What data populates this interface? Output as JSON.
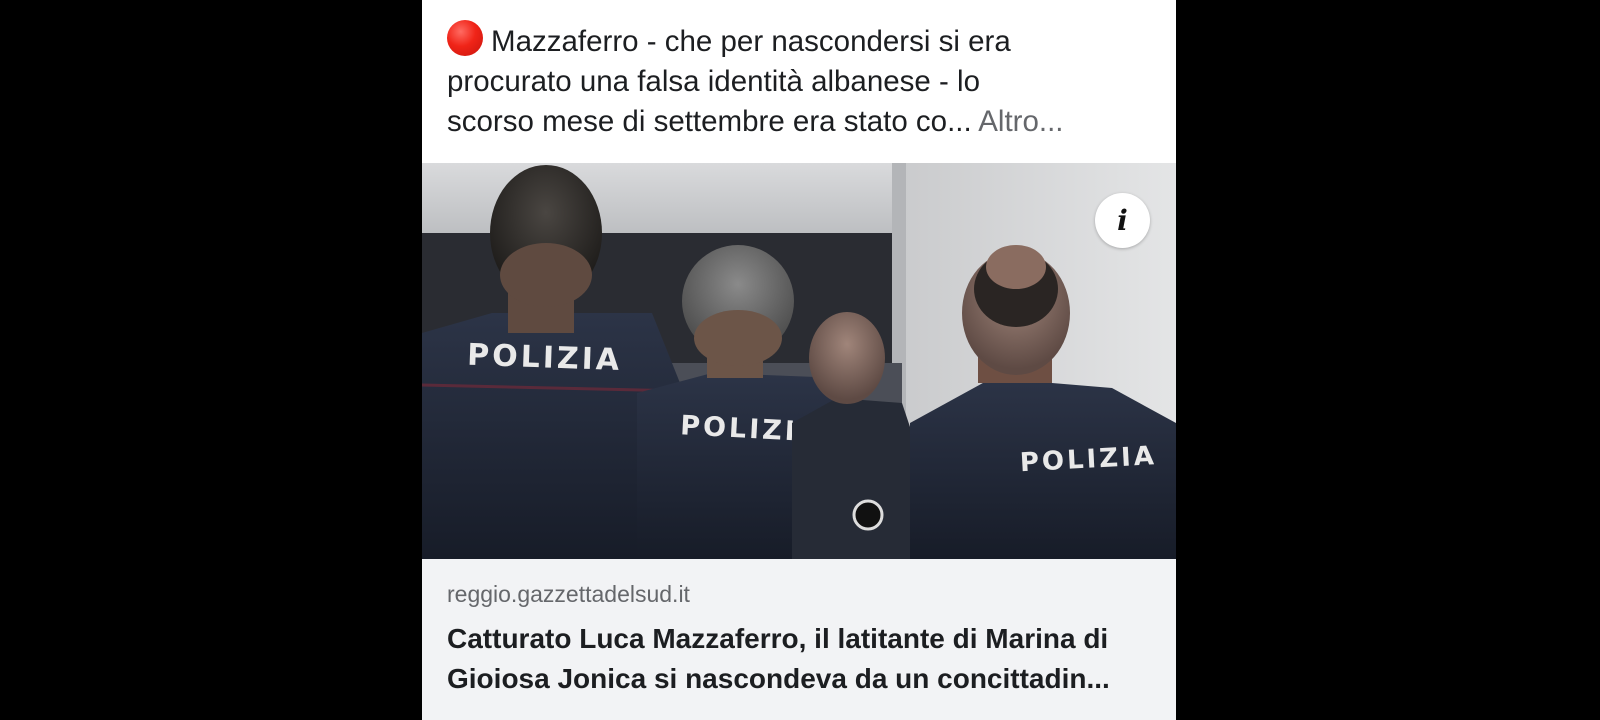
{
  "post": {
    "status_icon": "red-circle-icon",
    "text_line_1": "Mazzaferro - che per nascondersi si era",
    "text_line_2": "procurato una falsa identità albanese - lo",
    "text_line_3": "scorso mese di settembre era stato co...",
    "see_more_label": "Altro..."
  },
  "media": {
    "info_icon": "info-icon",
    "info_glyph": "i",
    "jacket_labels": [
      "POLIZIA",
      "POLIZIA",
      "POLIZIA"
    ]
  },
  "link_preview": {
    "domain": "reggio.gazzettadelsud.it",
    "title_line_1": "Catturato Luca Mazzaferro, il latitante di Marina di",
    "title_line_2": "Gioiosa Jonica si nascondeva da un concittadin..."
  },
  "colors": {
    "page_background": "#000000",
    "card_background": "#ffffff",
    "link_box_background": "#f2f3f5",
    "secondary_text": "#65676b",
    "primary_text": "#1c1e21",
    "red_dot": "#f02418"
  }
}
